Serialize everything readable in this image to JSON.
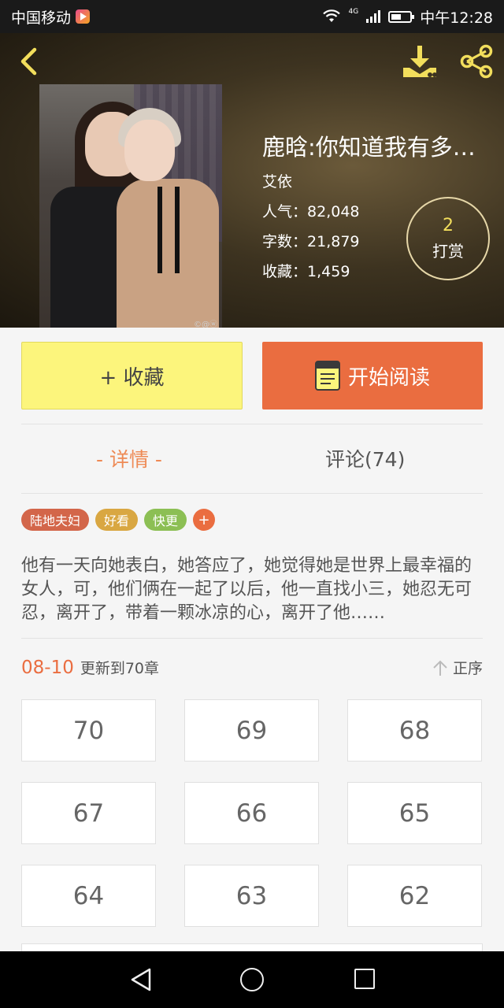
{
  "status_bar": {
    "carrier": "中国移动",
    "network": "4G",
    "time": "中午12:28"
  },
  "header": {
    "back_icon": "chevron-left-icon",
    "download_icon": "download-icon",
    "share_icon": "share-icon"
  },
  "book": {
    "title": "鹿晗:你知道我有多爱你吗",
    "author": "艾依",
    "popularity_label": "人气：",
    "popularity": "82,048",
    "words_label": "字数：",
    "words": "21,879",
    "favorites_label": "收藏：",
    "favorites": "1,459",
    "cover_watermark": "©@ⓦ"
  },
  "reward": {
    "count": "2",
    "label": "打赏"
  },
  "actions": {
    "favorite_label": "+ 收藏",
    "read_label": "开始阅读"
  },
  "tabs": {
    "detail": "- 详情 -",
    "comments": "评论(74)"
  },
  "tags": [
    {
      "label": "陆地夫妇",
      "color": "#d3664a"
    },
    {
      "label": "好看",
      "color": "#d9a742"
    },
    {
      "label": "快更",
      "color": "#8cbf54"
    }
  ],
  "tag_add": "+",
  "description": "他有一天向她表白，她答应了，她觉得她是世界上最幸福的女人，可，他们俩在一起了以后，他一直找小三，她忍无可忍，离开了，带着一颗冰凉的心，离开了他……",
  "update": {
    "date": "08-10",
    "text": "更新到70章",
    "sort_label": "正序"
  },
  "chapters": [
    "70",
    "69",
    "68",
    "67",
    "66",
    "65",
    "64",
    "63",
    "62"
  ],
  "colors": {
    "accent": "#ea6d40",
    "favorite_button": "#fcf57c",
    "reward_count": "#f2de5c"
  }
}
